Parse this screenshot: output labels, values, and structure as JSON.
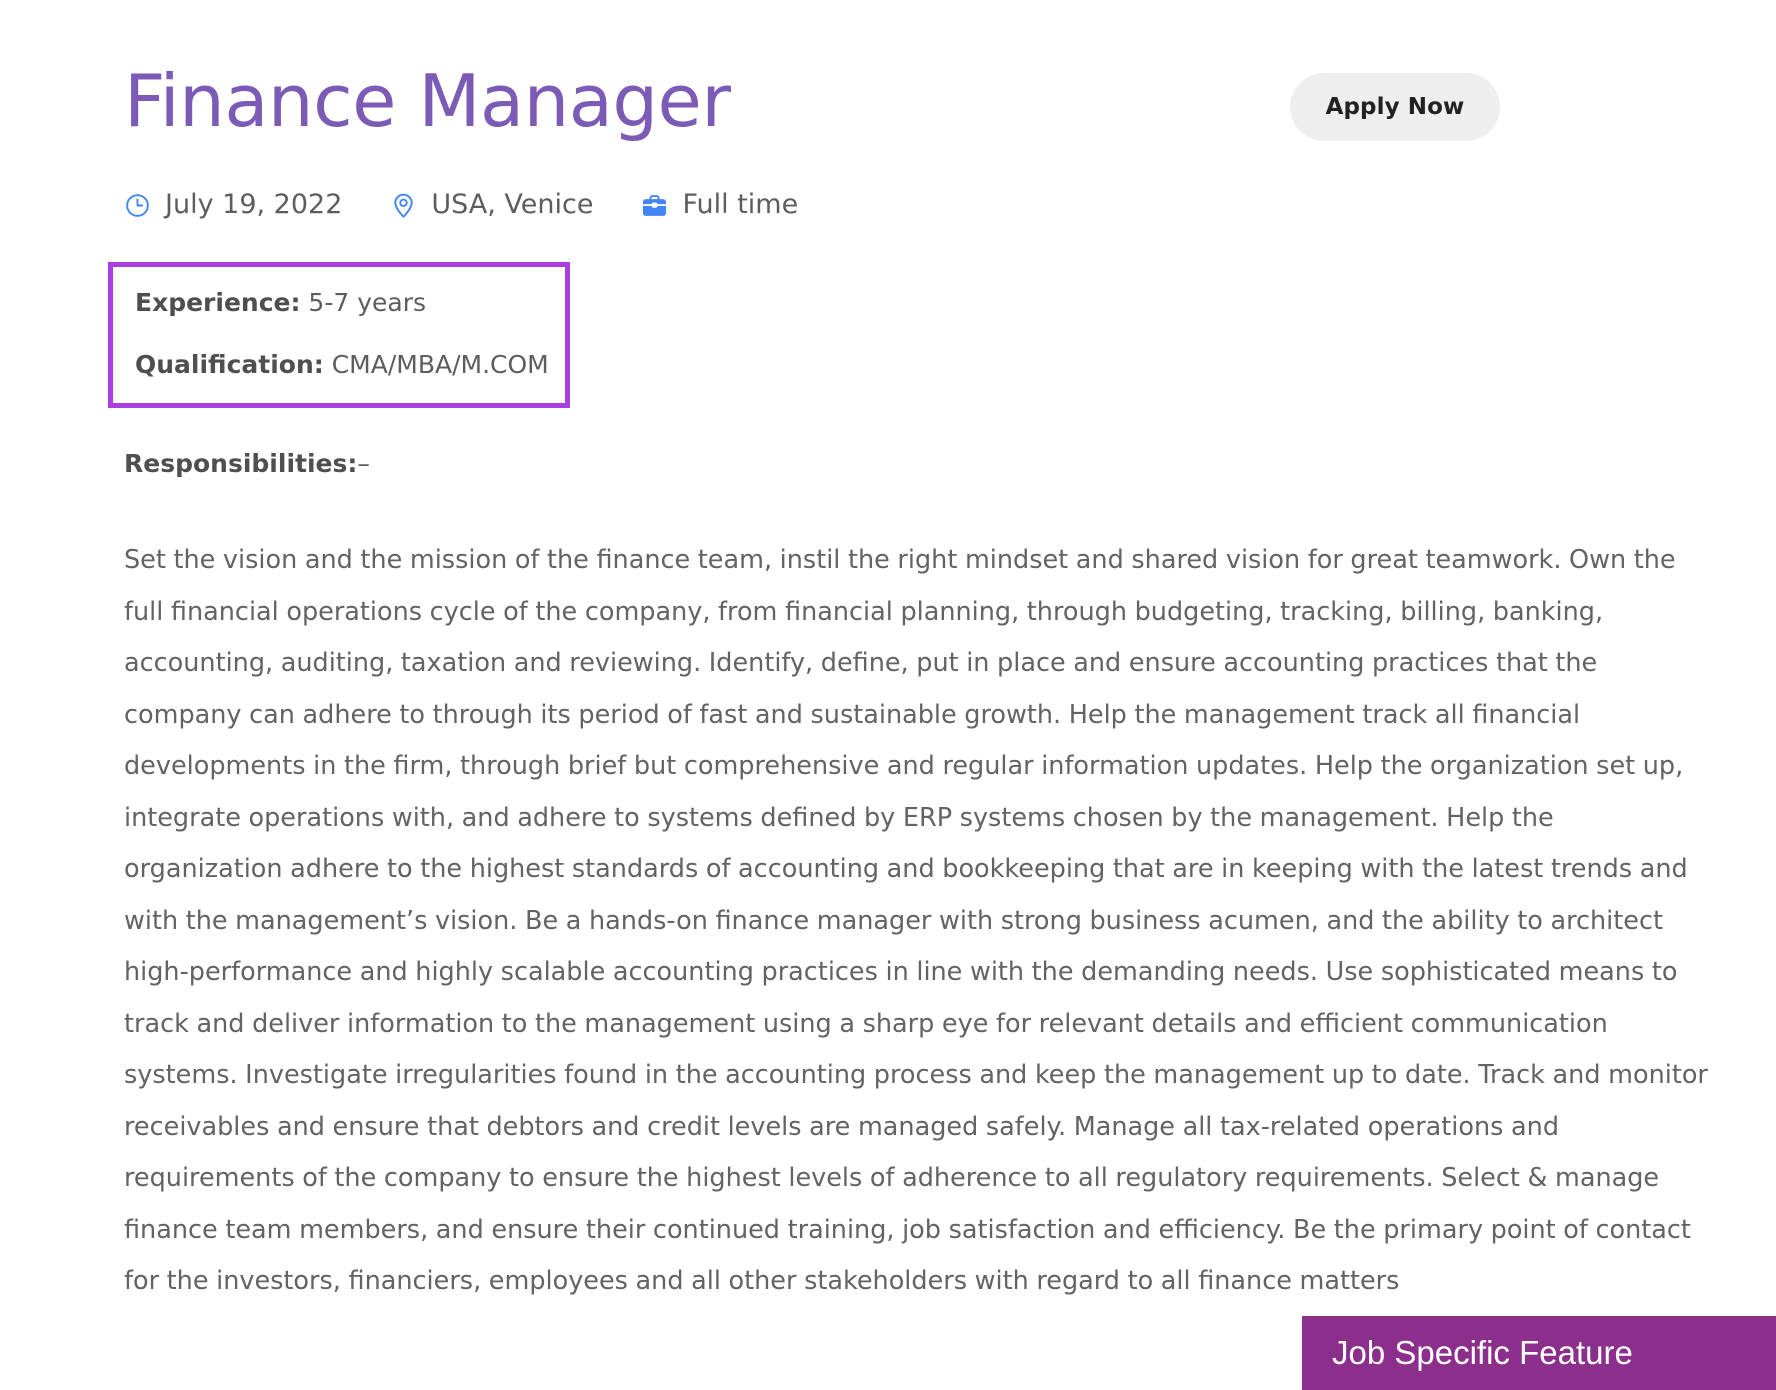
{
  "header": {
    "title": "Finance Manager",
    "share_icon": "share-icon",
    "apply_label": "Apply Now"
  },
  "meta": [
    {
      "icon": "clock-icon",
      "label": "July 19, 2022"
    },
    {
      "icon": "location-pin-icon",
      "label": "USA, Venice"
    },
    {
      "icon": "briefcase-icon",
      "label": "Full time"
    }
  ],
  "requirements": {
    "experience_label": "Experience:",
    "experience_value": " 5-7 years",
    "qualification_label": "Qualification:",
    "qualification_value": " CMA/MBA/M.COM"
  },
  "responsibilities": {
    "heading_label": "Responsibilities:",
    "heading_suffix": "–",
    "body": "Set the vision and the mission of the finance team, instil the right mindset and shared vision for great teamwork. Own the full financial operations cycle of the company, from financial planning, through budgeting, tracking, billing, banking, accounting, auditing, taxation and reviewing. Identify, define, put in place and ensure accounting practices that the company can adhere to through its period of fast and sustainable growth. Help the management track all financial developments in the firm, through brief but comprehensive and regular information updates. Help the organization set up, integrate operations with, and adhere to systems defined by ERP systems chosen by the management. Help the organization adhere to the highest standards of accounting and bookkeeping that are in keeping with the latest trends and with the management’s vision. Be a hands-on finance manager with strong business acumen, and the ability to architect high-performance and highly scalable accounting practices in line with the demanding needs. Use sophisticated means to track and deliver information to the management using a sharp eye for relevant details and efficient communication systems. Investigate irregularities found in the accounting process and keep the management up to date. Track and monitor receivables and ensure that debtors and credit levels are managed safely. Manage all tax-related operations and requirements of the company to ensure the highest levels of adherence to all regulatory requirements. Select & manage finance team members, and ensure their continued training, job satisfaction and efficiency. Be the primary point of contact for the investors, financiers, employees and all other stakeholders with regard to all finance matters"
  },
  "feature_banner": {
    "label": "Job Specific Feature"
  },
  "colors": {
    "title_purple": "#7b5bb5",
    "accent_blue": "#4285f4",
    "highlight_border": "#a93fe0",
    "banner_purple": "#8c2f8c",
    "apply_button_bg": "#eeeeee",
    "body_text": "#636363"
  }
}
